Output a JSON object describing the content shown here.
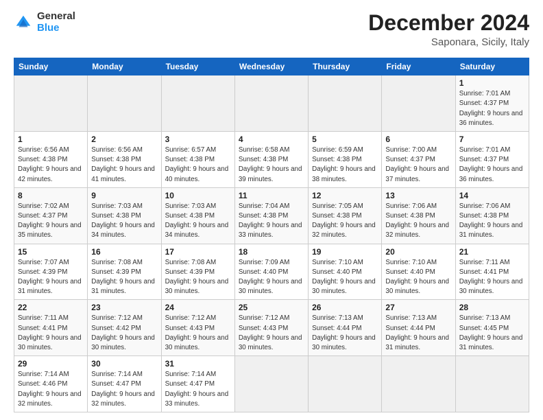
{
  "header": {
    "logo_general": "General",
    "logo_blue": "Blue",
    "title": "December 2024",
    "subtitle": "Saponara, Sicily, Italy"
  },
  "calendar": {
    "days_of_week": [
      "Sunday",
      "Monday",
      "Tuesday",
      "Wednesday",
      "Thursday",
      "Friday",
      "Saturday"
    ],
    "weeks": [
      [
        {
          "day": "",
          "info": ""
        },
        {
          "day": "",
          "info": ""
        },
        {
          "day": "",
          "info": ""
        },
        {
          "day": "",
          "info": ""
        },
        {
          "day": "",
          "info": ""
        },
        {
          "day": "",
          "info": ""
        },
        {
          "day": "1",
          "info": "Sunrise: 7:01 AM\nSunset: 4:37 PM\nDaylight: 9 hours\nand 36 minutes."
        }
      ],
      [
        {
          "day": "1",
          "info": "Sunrise: 6:56 AM\nSunset: 4:38 PM\nDaylight: 9 hours\nand 42 minutes."
        },
        {
          "day": "2",
          "info": "Sunrise: 6:56 AM\nSunset: 4:38 PM\nDaylight: 9 hours\nand 41 minutes."
        },
        {
          "day": "3",
          "info": "Sunrise: 6:57 AM\nSunset: 4:38 PM\nDaylight: 9 hours\nand 40 minutes."
        },
        {
          "day": "4",
          "info": "Sunrise: 6:58 AM\nSunset: 4:38 PM\nDaylight: 9 hours\nand 39 minutes."
        },
        {
          "day": "5",
          "info": "Sunrise: 6:59 AM\nSunset: 4:38 PM\nDaylight: 9 hours\nand 38 minutes."
        },
        {
          "day": "6",
          "info": "Sunrise: 7:00 AM\nSunset: 4:37 PM\nDaylight: 9 hours\nand 37 minutes."
        },
        {
          "day": "7",
          "info": "Sunrise: 7:01 AM\nSunset: 4:37 PM\nDaylight: 9 hours\nand 36 minutes."
        }
      ],
      [
        {
          "day": "8",
          "info": "Sunrise: 7:02 AM\nSunset: 4:37 PM\nDaylight: 9 hours\nand 35 minutes."
        },
        {
          "day": "9",
          "info": "Sunrise: 7:03 AM\nSunset: 4:38 PM\nDaylight: 9 hours\nand 34 minutes."
        },
        {
          "day": "10",
          "info": "Sunrise: 7:03 AM\nSunset: 4:38 PM\nDaylight: 9 hours\nand 34 minutes."
        },
        {
          "day": "11",
          "info": "Sunrise: 7:04 AM\nSunset: 4:38 PM\nDaylight: 9 hours\nand 33 minutes."
        },
        {
          "day": "12",
          "info": "Sunrise: 7:05 AM\nSunset: 4:38 PM\nDaylight: 9 hours\nand 32 minutes."
        },
        {
          "day": "13",
          "info": "Sunrise: 7:06 AM\nSunset: 4:38 PM\nDaylight: 9 hours\nand 32 minutes."
        },
        {
          "day": "14",
          "info": "Sunrise: 7:06 AM\nSunset: 4:38 PM\nDaylight: 9 hours\nand 31 minutes."
        }
      ],
      [
        {
          "day": "15",
          "info": "Sunrise: 7:07 AM\nSunset: 4:39 PM\nDaylight: 9 hours\nand 31 minutes."
        },
        {
          "day": "16",
          "info": "Sunrise: 7:08 AM\nSunset: 4:39 PM\nDaylight: 9 hours\nand 31 minutes."
        },
        {
          "day": "17",
          "info": "Sunrise: 7:08 AM\nSunset: 4:39 PM\nDaylight: 9 hours\nand 30 minutes."
        },
        {
          "day": "18",
          "info": "Sunrise: 7:09 AM\nSunset: 4:40 PM\nDaylight: 9 hours\nand 30 minutes."
        },
        {
          "day": "19",
          "info": "Sunrise: 7:10 AM\nSunset: 4:40 PM\nDaylight: 9 hours\nand 30 minutes."
        },
        {
          "day": "20",
          "info": "Sunrise: 7:10 AM\nSunset: 4:40 PM\nDaylight: 9 hours\nand 30 minutes."
        },
        {
          "day": "21",
          "info": "Sunrise: 7:11 AM\nSunset: 4:41 PM\nDaylight: 9 hours\nand 30 minutes."
        }
      ],
      [
        {
          "day": "22",
          "info": "Sunrise: 7:11 AM\nSunset: 4:41 PM\nDaylight: 9 hours\nand 30 minutes."
        },
        {
          "day": "23",
          "info": "Sunrise: 7:12 AM\nSunset: 4:42 PM\nDaylight: 9 hours\nand 30 minutes."
        },
        {
          "day": "24",
          "info": "Sunrise: 7:12 AM\nSunset: 4:43 PM\nDaylight: 9 hours\nand 30 minutes."
        },
        {
          "day": "25",
          "info": "Sunrise: 7:12 AM\nSunset: 4:43 PM\nDaylight: 9 hours\nand 30 minutes."
        },
        {
          "day": "26",
          "info": "Sunrise: 7:13 AM\nSunset: 4:44 PM\nDaylight: 9 hours\nand 30 minutes."
        },
        {
          "day": "27",
          "info": "Sunrise: 7:13 AM\nSunset: 4:44 PM\nDaylight: 9 hours\nand 31 minutes."
        },
        {
          "day": "28",
          "info": "Sunrise: 7:13 AM\nSunset: 4:45 PM\nDaylight: 9 hours\nand 31 minutes."
        }
      ],
      [
        {
          "day": "29",
          "info": "Sunrise: 7:14 AM\nSunset: 4:46 PM\nDaylight: 9 hours\nand 32 minutes."
        },
        {
          "day": "30",
          "info": "Sunrise: 7:14 AM\nSunset: 4:47 PM\nDaylight: 9 hours\nand 32 minutes."
        },
        {
          "day": "31",
          "info": "Sunrise: 7:14 AM\nSunset: 4:47 PM\nDaylight: 9 hours\nand 33 minutes."
        },
        {
          "day": "",
          "info": ""
        },
        {
          "day": "",
          "info": ""
        },
        {
          "day": "",
          "info": ""
        },
        {
          "day": "",
          "info": ""
        }
      ]
    ]
  }
}
